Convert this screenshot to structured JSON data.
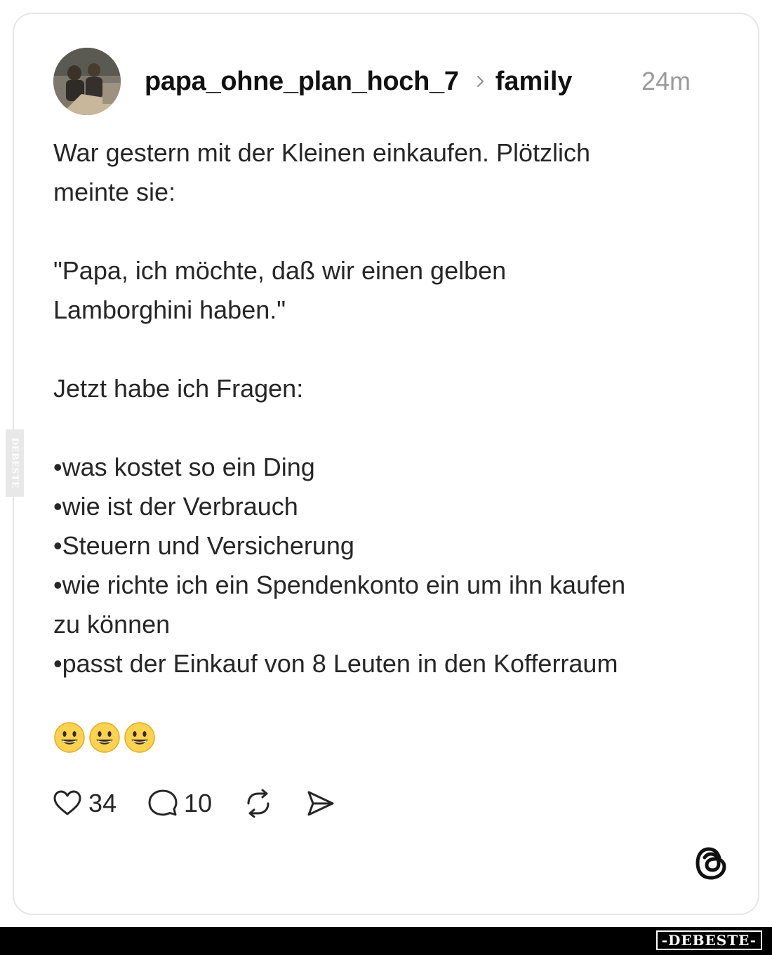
{
  "post": {
    "author": "papa_ohne_plan_hoch_7",
    "community": "family",
    "time": "24m",
    "text": {
      "p1": [
        "War gestern mit der Kleinen einkaufen. Plötzlich",
        "meinte sie:"
      ],
      "p2": [
        "\"Papa, ich möchte, daß wir einen gelben",
        "Lamborghini haben.\""
      ],
      "p3": [
        "Jetzt habe ich Fragen:"
      ],
      "bullets": [
        "•was kostet so ein Ding",
        "•wie ist der Verbrauch",
        "•Steuern und Versicherung",
        "•wie richte ich ein Spendenkonto ein um ihn kaufen",
        "zu können",
        "•passt der Einkauf von 8 Leuten in den Kofferraum"
      ]
    },
    "emojis": [
      "grinning-face",
      "grinning-face",
      "grinning-face"
    ],
    "likes": "34",
    "replies": "10"
  },
  "icons": {
    "like": "heart-icon",
    "reply": "speech-bubble-icon",
    "repost": "repost-icon",
    "share": "send-icon",
    "app": "threads-logo-icon"
  },
  "watermark": {
    "side": "DEBESTE",
    "footer": "-DEBESTE-"
  }
}
